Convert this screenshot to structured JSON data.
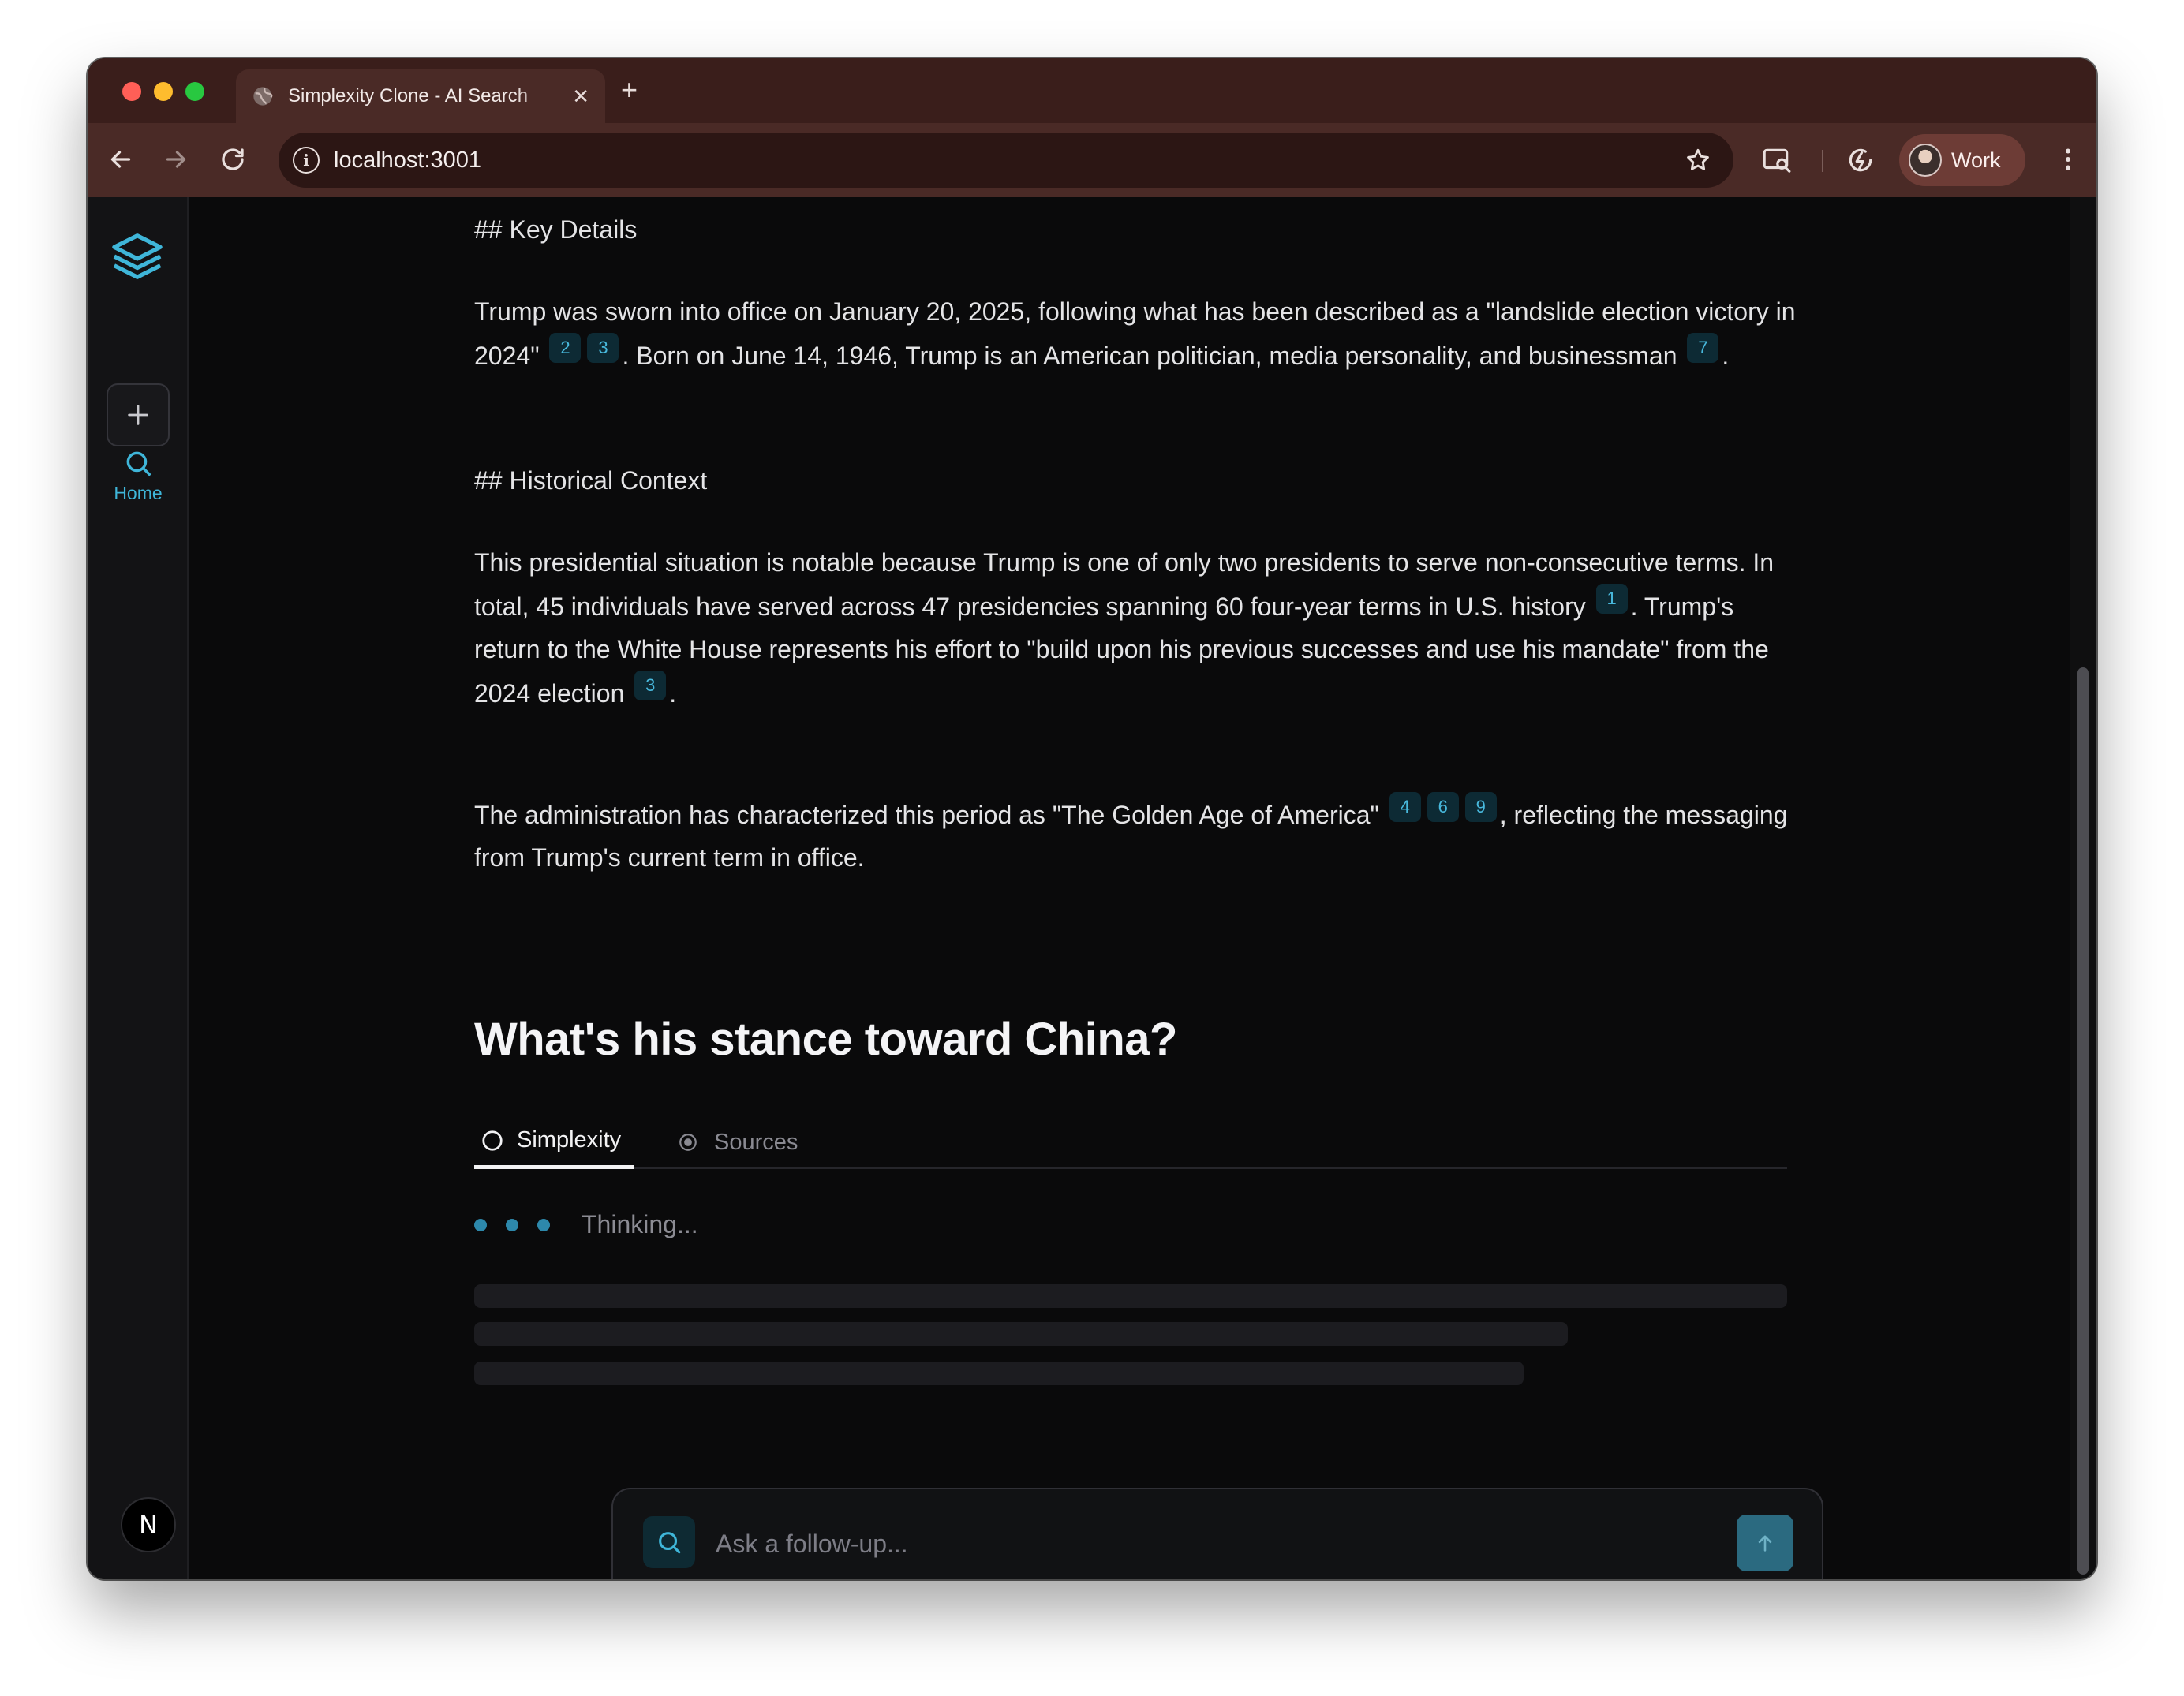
{
  "browser": {
    "tab_title": "Simplexity Clone - AI Search",
    "new_tab_symbol": "+",
    "close_symbol": "✕",
    "url": "localhost:3001",
    "profile_name": "Work"
  },
  "sidebar": {
    "home_label": "Home",
    "user_initial": "N",
    "accent_color": "#3fb6d9"
  },
  "answer": {
    "heading_key_details": "## Key Details",
    "p1": {
      "before": "Trump was sworn into office on January 20, 2025, following what has been described as a \"landslide election victory in 2024\"",
      "cites_a": [
        "2",
        "3"
      ],
      "middle": ". Born on June 14, 1946, Trump is an American politician, media personality, and businessman",
      "cites_b": [
        "7"
      ],
      "end": "."
    },
    "heading_historical": "## Historical Context",
    "p2": {
      "before": "This presidential situation is notable because Trump is one of only two presidents to serve non-consecutive terms. In total, 45 individuals have served across 47 presidencies spanning 60 four-year terms in U.S. history",
      "cites_a": [
        "1"
      ],
      "middle": ". Trump's return to the White House represents his effort to \"build upon his previous successes and use his mandate\" from the 2024 election",
      "cites_b": [
        "3"
      ],
      "end": "."
    },
    "p3": {
      "before": "The administration has characterized this period as \"The Golden Age of America\"",
      "cites_a": [
        "4",
        "6",
        "9"
      ],
      "end": ", reflecting the messaging from Trump's current term in office."
    }
  },
  "followup_question": {
    "title": "What's his stance toward China?",
    "tabs": [
      {
        "label": "Simplexity",
        "active": true
      },
      {
        "label": "Sources",
        "active": false
      }
    ],
    "status": "Thinking..."
  },
  "search": {
    "placeholder": "Ask a follow-up..."
  }
}
